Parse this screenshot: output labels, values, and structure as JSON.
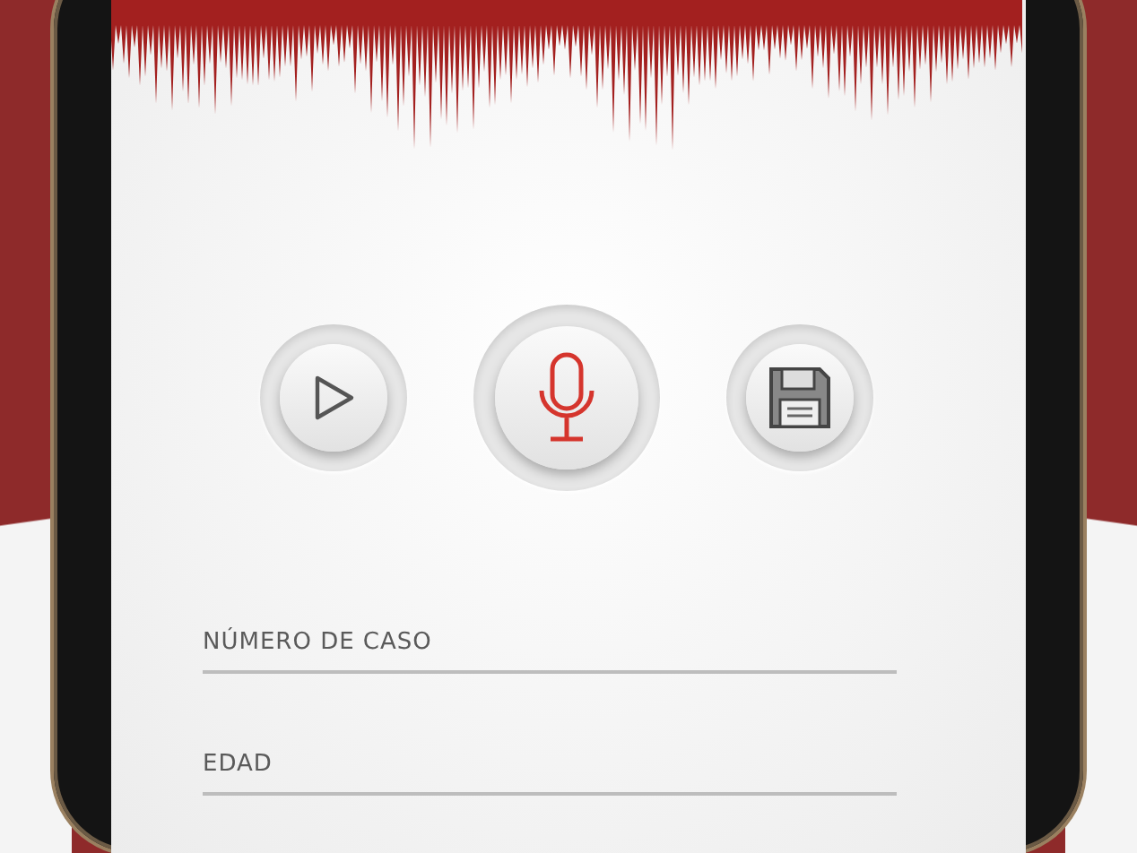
{
  "buttons": [
    {
      "kind": "play"
    },
    {
      "kind": "record"
    },
    {
      "kind": "save"
    }
  ],
  "fields": [
    {
      "placeholder": "NÚMERO DE CASO"
    },
    {
      "placeholder": "EDAD"
    }
  ]
}
